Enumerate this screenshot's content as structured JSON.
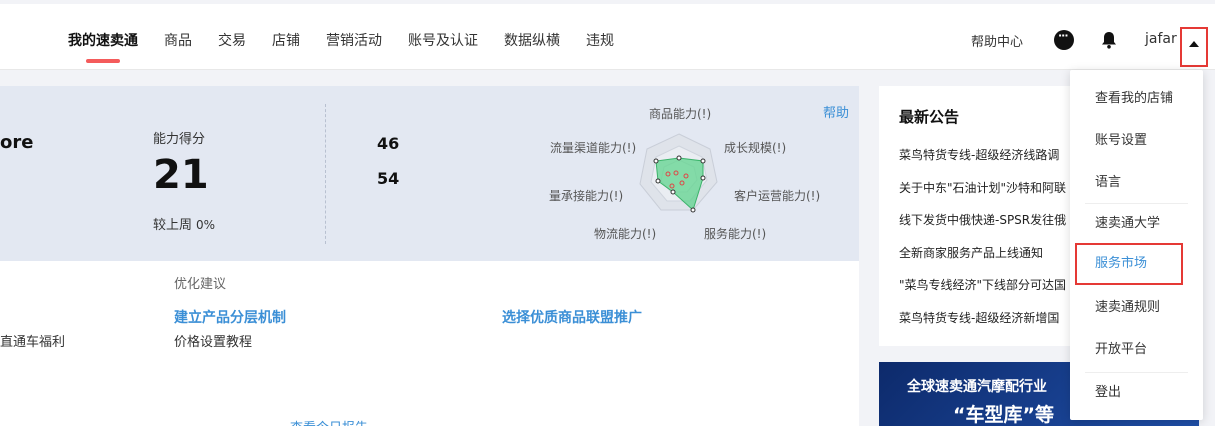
{
  "nav": {
    "items": [
      "我的速卖通",
      "商品",
      "交易",
      "店铺",
      "营销活动",
      "账号及认证",
      "数据纵横",
      "违规"
    ],
    "active_index": 0,
    "help_center": "帮助中心",
    "user": "jafar"
  },
  "score": {
    "store_label": "ore",
    "ability_label": "能力得分",
    "ability_value": "21",
    "prev_week_label": "较上周",
    "prev_week_value": "0%",
    "stat1": "46",
    "stat2": "54",
    "help": "帮助"
  },
  "radar": {
    "labels": [
      "商品能力(!)",
      "成长规模(!)",
      "客户运营能力(!)",
      "服务能力(!)",
      "物流能力(!)",
      "流量承接能力(!)",
      "流量渠道能力(!)"
    ],
    "label_left": "量承接能力(!)"
  },
  "suggest": {
    "title": "优化建议",
    "link1": "建立产品分层机制",
    "link2": "选择优质商品联盟推广",
    "left_text": "直通车福利",
    "sub_text": "价格设置教程",
    "bottom_text": "查看今日报告"
  },
  "notices": {
    "title": "最新公告",
    "items": [
      "菜鸟特货专线-超级经济线路调",
      "关于中东\"石油计划\"沙特和阿联",
      "线下发货中俄快递-SPSR发往俄",
      "全新商家服务产品上线通知",
      "\"菜鸟专线经济\"下线部分可达国",
      "菜鸟特货专线-超级经济新增国"
    ]
  },
  "banner": {
    "line1": "全球速卖通汽摩配行业",
    "line2": "“车型库”等"
  },
  "dropdown": {
    "items": [
      "查看我的店铺",
      "账号设置",
      "语言",
      "速卖通大学",
      "服务市场",
      "速卖通规则",
      "开放平台",
      "登出"
    ],
    "highlight_index": 4
  }
}
